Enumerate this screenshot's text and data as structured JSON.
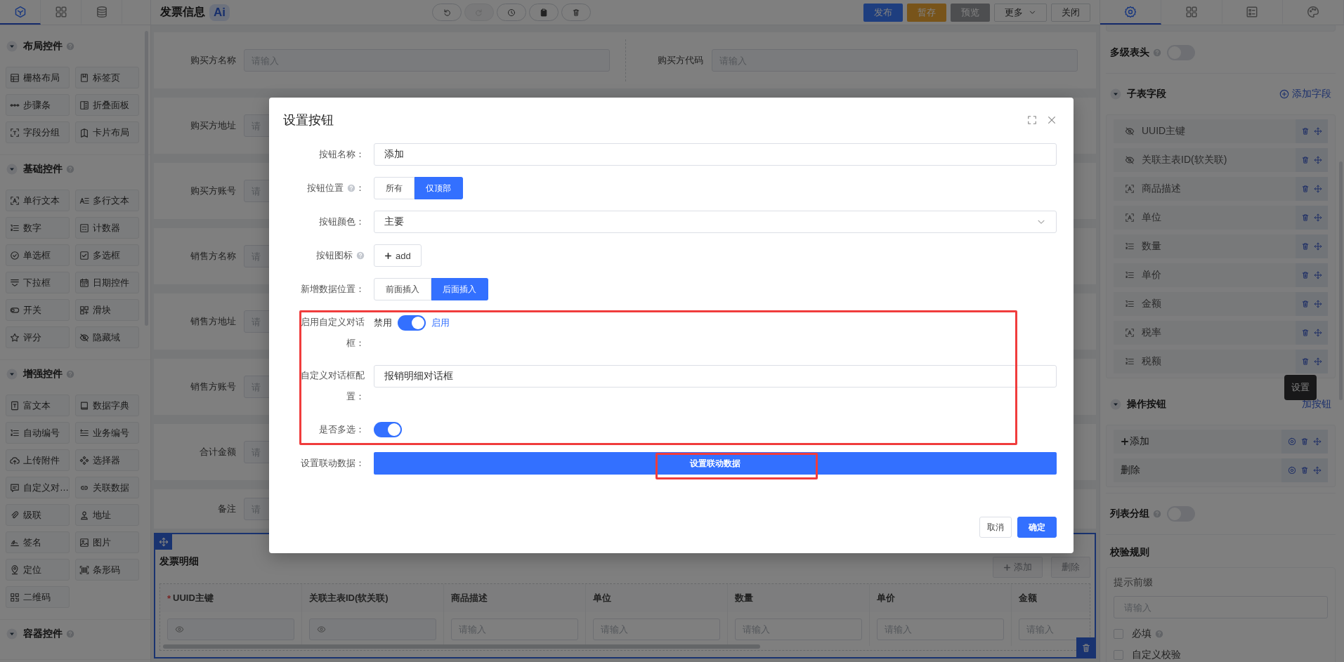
{
  "left_panel": {
    "tabs": [
      {
        "selected": true
      },
      {
        "selected": false
      },
      {
        "selected": false
      }
    ],
    "sections": [
      {
        "title": "布局控件",
        "help": true,
        "items": [
          "栅格布局",
          "标签页",
          "步骤条",
          "折叠面板",
          "字段分组",
          "卡片布局"
        ]
      },
      {
        "title": "基础控件",
        "help": true,
        "items": [
          "单行文本",
          "多行文本",
          "数字",
          "计数器",
          "单选框",
          "多选框",
          "下拉框",
          "日期控件",
          "开关",
          "滑块",
          "评分",
          "隐藏域"
        ]
      },
      {
        "title": "增强控件",
        "help": true,
        "items": [
          "富文本",
          "数据字典",
          "自动编号",
          "业务编号",
          "上传附件",
          "选择器",
          "自定义对…",
          "关联数据",
          "级联",
          "地址",
          "签名",
          "图片",
          "定位",
          "条形码",
          "二维码"
        ]
      },
      {
        "title": "容器控件",
        "help": true
      }
    ]
  },
  "toolbar": {
    "title": "发票信息",
    "logo_text": "Ai",
    "actions": [
      {
        "disabled": false
      },
      {
        "disabled": true
      },
      {
        "disabled": false
      },
      {
        "disabled": false
      },
      {
        "disabled": false
      }
    ],
    "buttons": [
      {
        "label": "发布",
        "kind": "primary"
      },
      {
        "label": "暂存",
        "kind": "warning"
      },
      {
        "label": "预览",
        "kind": "secondary"
      },
      {
        "label": "更多",
        "kind": "dropdown"
      },
      {
        "label": "关闭",
        "kind": "default"
      }
    ]
  },
  "form": {
    "rows": [
      {
        "fields": [
          {
            "label": "购买方名称",
            "placeholder": "请输入"
          },
          {
            "label": "购买方代码",
            "placeholder": "请输入"
          }
        ]
      },
      {
        "fields": [
          {
            "label": "购买方地址",
            "placeholder": "请"
          }
        ]
      },
      {
        "fields": [
          {
            "label": "购买方账号",
            "placeholder": "请"
          }
        ]
      },
      {
        "fields": [
          {
            "label": "销售方名称",
            "placeholder": "请"
          }
        ]
      },
      {
        "fields": [
          {
            "label": "销售方地址",
            "placeholder": "请"
          }
        ]
      },
      {
        "fields": [
          {
            "label": "销售方账号",
            "placeholder": "请"
          }
        ]
      },
      {
        "fields": [
          {
            "label": "合计金额",
            "placeholder": "请"
          }
        ]
      },
      {
        "fields": [
          {
            "label": "备注",
            "placeholder": "请"
          }
        ],
        "kind": "short"
      }
    ]
  },
  "subtable": {
    "title": "发票明细",
    "buttons": [
      {
        "label": "添加",
        "kind": "add",
        "disabled": true
      },
      {
        "label": "删除",
        "kind": "plain",
        "disabled": true
      }
    ],
    "columns": [
      {
        "title": "UUID主键",
        "required_mark": "*",
        "cell": {
          "kind": "hidden"
        }
      },
      {
        "title": "关联主表ID(软关联)",
        "cell": {
          "kind": "hidden"
        }
      },
      {
        "title": "商品描述",
        "cell": {
          "kind": "input",
          "placeholder": "请输入"
        }
      },
      {
        "title": "单位",
        "cell": {
          "kind": "input",
          "placeholder": "请输入"
        }
      },
      {
        "title": "数量",
        "cell": {
          "kind": "input",
          "placeholder": "请输入"
        }
      },
      {
        "title": "单价",
        "cell": {
          "kind": "input",
          "placeholder": "请输入"
        }
      },
      {
        "title": "金额",
        "cell": {
          "kind": "input",
          "placeholder": "请输入"
        }
      }
    ]
  },
  "right_panel": {
    "tabs": [
      {
        "selected": true
      },
      {
        "selected": false
      },
      {
        "selected": false
      },
      {
        "selected": false
      }
    ],
    "multi_header": {
      "label": "多级表头",
      "help": true,
      "on": false
    },
    "fields_section": {
      "title": "子表字段",
      "action": "添加字段",
      "items": [
        {
          "label": "UUID主键",
          "kind": "hidden"
        },
        {
          "label": "关联主表ID(软关联)",
          "kind": "hidden"
        },
        {
          "label": "商品描述",
          "kind": "text"
        },
        {
          "label": "单位",
          "kind": "text"
        },
        {
          "label": "数量",
          "kind": "number"
        },
        {
          "label": "单价",
          "kind": "number"
        },
        {
          "label": "金额",
          "kind": "number"
        },
        {
          "label": "税率",
          "kind": "text"
        },
        {
          "label": "税额",
          "kind": "number"
        }
      ]
    },
    "buttons_section": {
      "title": "操作按钮",
      "action": "加按钮",
      "tooltip": "设置",
      "items": [
        {
          "label": "添加",
          "kind": "add"
        },
        {
          "label": "删除",
          "kind": "plain"
        }
      ]
    },
    "list_group": {
      "label": "列表分组",
      "help": true,
      "on": false
    },
    "validation": {
      "title": "校验规则",
      "prefix_label": "提示前缀",
      "prefix_placeholder": "请输入",
      "checks": [
        {
          "label": "必填",
          "help": true,
          "checked": false
        },
        {
          "label": "自定义校验",
          "checked": false
        }
      ]
    }
  },
  "dialog": {
    "title": "设置按钮",
    "rows": [
      {
        "label": "按钮名称：",
        "kind": "input",
        "value": "添加"
      },
      {
        "label": "按钮位置",
        "help": true,
        "suffix": "：",
        "kind": "segmented",
        "options": [
          {
            "label": "所有",
            "selected": false
          },
          {
            "label": "仅顶部",
            "selected": true
          }
        ]
      },
      {
        "label": "按钮颜色：",
        "kind": "select",
        "value": "主要"
      },
      {
        "label": "按钮图标",
        "help": true,
        "kind": "icon_button",
        "value": "add"
      },
      {
        "label": "新增数据位置：",
        "kind": "segmented",
        "options": [
          {
            "label": "前面插入",
            "selected": false
          },
          {
            "label": "后面插入",
            "selected": true
          }
        ]
      },
      {
        "label": "启用自定义对话框：",
        "kind": "switch",
        "on": true,
        "off_text": "禁用",
        "on_text": "启用"
      },
      {
        "label": "自定义对话框配置：",
        "kind": "input",
        "value": "报销明细对话框"
      },
      {
        "label": "是否多选：",
        "kind": "switch",
        "on": true
      },
      {
        "label": "设置联动数据：",
        "kind": "block_button",
        "value": "设置联动数据"
      }
    ],
    "buttons": [
      {
        "label": "取消",
        "kind": "default"
      },
      {
        "label": "确定",
        "kind": "primary"
      }
    ],
    "annotations": [
      {
        "kind": "highlight_box"
      },
      {
        "kind": "highlight_box"
      }
    ]
  }
}
